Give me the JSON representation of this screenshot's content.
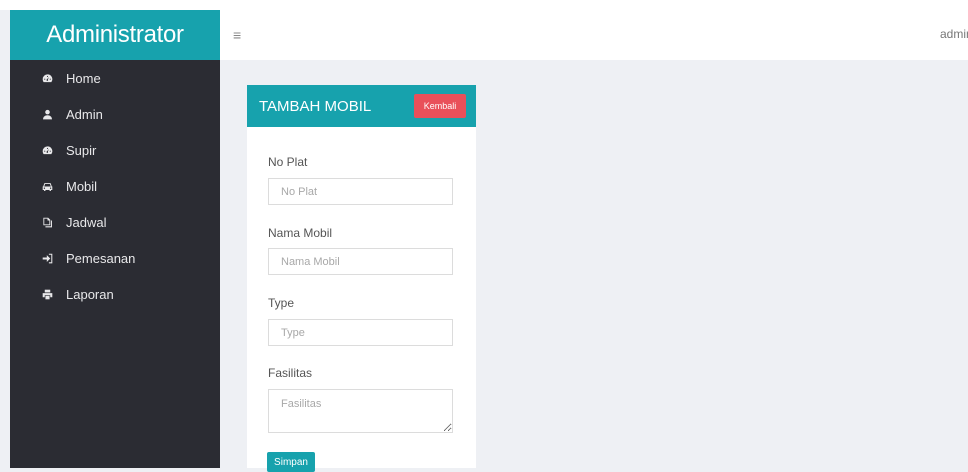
{
  "app": {
    "brand": "Administrator"
  },
  "header": {
    "menu_icon": "≡",
    "user": "admin"
  },
  "sidebar": {
    "items": [
      {
        "label": "Home",
        "icon": "dashboard-icon"
      },
      {
        "label": "Admin",
        "icon": "user-icon"
      },
      {
        "label": "Supir",
        "icon": "dashboard-icon"
      },
      {
        "label": "Mobil",
        "icon": "car-icon"
      },
      {
        "label": "Jadwal",
        "icon": "copy-icon"
      },
      {
        "label": "Pemesanan",
        "icon": "sign-in-icon"
      },
      {
        "label": "Laporan",
        "icon": "print-icon"
      }
    ]
  },
  "form": {
    "title": "TAMBAH MOBIL",
    "back_label": "Kembali",
    "fields": [
      {
        "label": "No Plat",
        "placeholder": "No Plat",
        "value": ""
      },
      {
        "label": "Nama Mobil",
        "placeholder": "Nama Mobil",
        "value": ""
      },
      {
        "label": "Type",
        "placeholder": "Type",
        "value": ""
      },
      {
        "label": "Fasilitas",
        "placeholder": "Fasilitas",
        "value": ""
      }
    ],
    "submit_label": "Simpan"
  },
  "colors": {
    "accent": "#17a2ad",
    "sidebar": "#2b2c33",
    "danger": "#e9505a",
    "background": "#eef0f4"
  }
}
